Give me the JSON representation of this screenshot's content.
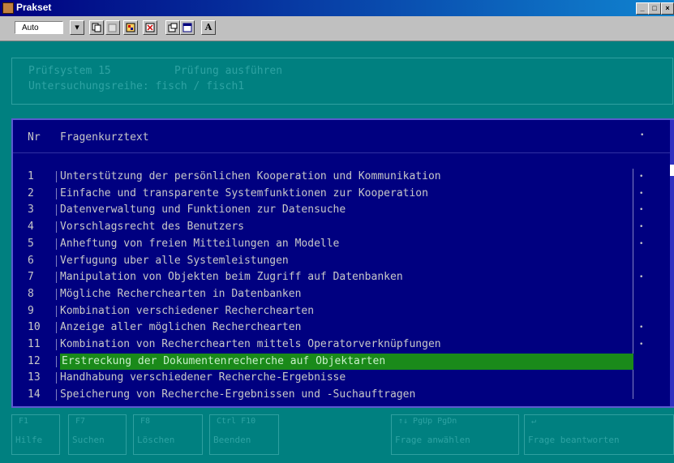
{
  "window": {
    "title": "Prakset",
    "minimize": "_",
    "maximize": "□",
    "close": "×"
  },
  "toolbar": {
    "font_select": "Auto",
    "buttons": [
      "dropdown-icon",
      "copy-icon",
      "paste-icon",
      "image-icon",
      "fullscreen-icon",
      "properties-icon",
      "window-icon",
      "font-icon"
    ],
    "font_label": "A"
  },
  "header": {
    "line1": "Prüfsystem 15          Prüfung ausführen",
    "line2": "Untersuchungsreihe: fisch / fisch1"
  },
  "table": {
    "col_nr": "Nr",
    "col_text": "Fragenkurztext",
    "rows": [
      {
        "nr": "1",
        "text": "Unterstützung der persönlichen Kooperation und Kommunikation",
        "mark": "•"
      },
      {
        "nr": "2",
        "text": "Einfache und transparente Systemfunktionen zur Kooperation",
        "mark": "•"
      },
      {
        "nr": "3",
        "text": "Datenverwaltung und Funktionen zur Datensuche",
        "mark": "•"
      },
      {
        "nr": "4",
        "text": "Vorschlagsrecht des Benutzers",
        "mark": "•"
      },
      {
        "nr": "5",
        "text": "Anheftung von freien Mitteilungen an Modelle",
        "mark": "•"
      },
      {
        "nr": "6",
        "text": "Verfugung uber alle Systemleistungen",
        "mark": ""
      },
      {
        "nr": "7",
        "text": "Manipulation von Objekten beim Zugriff auf Datenbanken",
        "mark": "•"
      },
      {
        "nr": "8",
        "text": "Mögliche Recherchearten in Datenbanken",
        "mark": ""
      },
      {
        "nr": "9",
        "text": "Kombination verschiedener Recherchearten",
        "mark": ""
      },
      {
        "nr": "10",
        "text": "Anzeige aller möglichen Recherchearten",
        "mark": "•"
      },
      {
        "nr": "11",
        "text": "Kombination von Recherchearten mittels Operatorverknüpfungen",
        "mark": "•"
      },
      {
        "nr": "12",
        "text": "Erstreckung der Dokumentenrecherche auf Objektarten",
        "mark": "",
        "selected": true
      },
      {
        "nr": "13",
        "text": "Handhabung verschiedener Recherche-Ergebnisse",
        "mark": ""
      },
      {
        "nr": "14",
        "text": "Speicherung von Recherche-Ergebnissen und -Suchauftragen",
        "mark": ""
      }
    ]
  },
  "fkeys": [
    {
      "key": "F1",
      "label": "Hilfe"
    },
    {
      "key": "F7",
      "label": "Suchen"
    },
    {
      "key": "F8",
      "label": "Löschen"
    },
    {
      "key": "Ctrl F10",
      "label": "Beenden"
    },
    {
      "key": "↑↓ PgUp PgDn",
      "label": "Frage anwählen"
    },
    {
      "key": "↵",
      "label": "Frage beantworten"
    }
  ],
  "colors": {
    "terminal_bg": "#008080",
    "panel_bg": "#000080",
    "selection": "#1a8a1a"
  }
}
